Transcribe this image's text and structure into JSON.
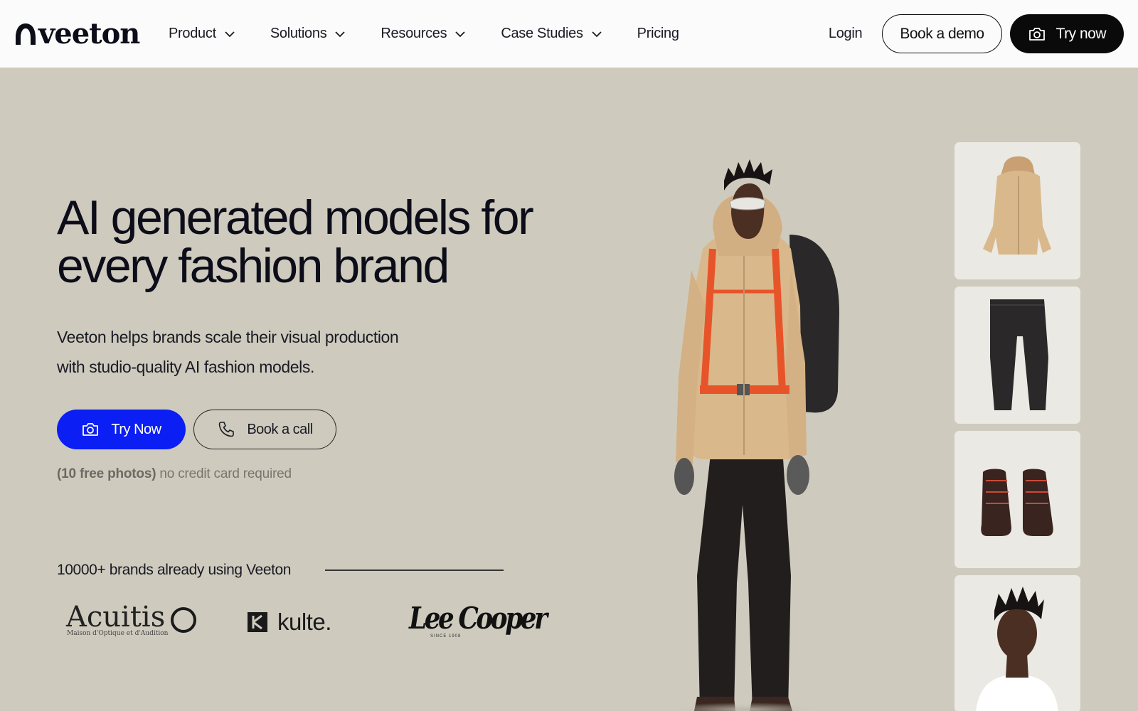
{
  "brand": {
    "logo_text": "veeton"
  },
  "nav": {
    "items": [
      {
        "label": "Product",
        "has_dropdown": true
      },
      {
        "label": "Solutions",
        "has_dropdown": true
      },
      {
        "label": "Resources",
        "has_dropdown": true
      },
      {
        "label": "Case Studies",
        "has_dropdown": true
      },
      {
        "label": "Pricing",
        "has_dropdown": false
      }
    ],
    "login": "Login",
    "book_demo": "Book a demo",
    "try_now": "Try now"
  },
  "hero": {
    "title_line1": "AI generated models for",
    "title_line2": "every fashion brand",
    "subtitle_line1": "Veeton helps brands scale their visual production",
    "subtitle_line2": "with studio-quality AI fashion models.",
    "cta_primary": "Try Now",
    "cta_secondary": "Book a call",
    "note_bold": "(10 free photos)",
    "note_rest": " no credit card required"
  },
  "brands": {
    "label": "10000+ brands already using Veeton",
    "logos": [
      {
        "name": "Acuitis",
        "tagline": "Maison d'Optique et d'Audition"
      },
      {
        "name": "kulte."
      },
      {
        "name": "Lee Cooper",
        "tagline": "SINCE 1908"
      }
    ]
  },
  "colors": {
    "background": "#cecbbe",
    "nav_bg": "#fbfbfb",
    "primary_blue": "#0b1ef3",
    "dark": "#0a0a0a"
  }
}
